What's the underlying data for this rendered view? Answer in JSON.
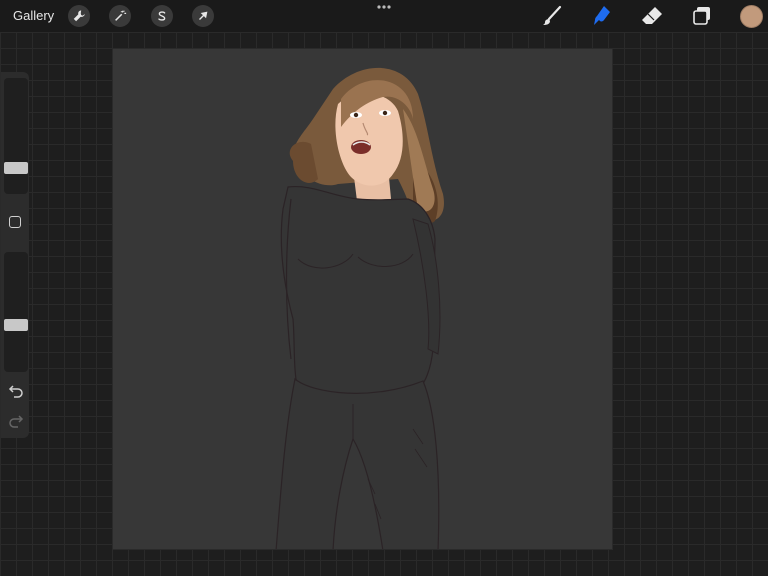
{
  "topbar": {
    "gallery_label": "Gallery",
    "left_tools": [
      {
        "name": "actions",
        "icon": "wrench-icon"
      },
      {
        "name": "adjustments",
        "icon": "magic-wand-icon"
      },
      {
        "name": "selection",
        "icon": "selection-s-icon"
      },
      {
        "name": "transform",
        "icon": "arrow-cursor-icon"
      }
    ],
    "more_icon": "more-dots-icon",
    "right_tools": [
      {
        "name": "brush",
        "icon": "brush-icon",
        "active": false
      },
      {
        "name": "smudge",
        "icon": "smudge-icon",
        "active": true
      },
      {
        "name": "eraser",
        "icon": "eraser-icon",
        "active": false
      },
      {
        "name": "layers",
        "icon": "layers-icon",
        "active": false
      }
    ],
    "current_color": "#c29a7c",
    "active_tool_color": "#1e6cf0"
  },
  "sidebar": {
    "brush_size_icon": "brush-size-slider",
    "modify_icon": "square-icon",
    "opacity_icon": "opacity-slider",
    "undo_icon": "undo-icon",
    "redo_icon": "redo-icon"
  },
  "canvas": {
    "background": "#373737",
    "artwork": "woman-in-dark-long-sleeve-shirt-illustration"
  }
}
